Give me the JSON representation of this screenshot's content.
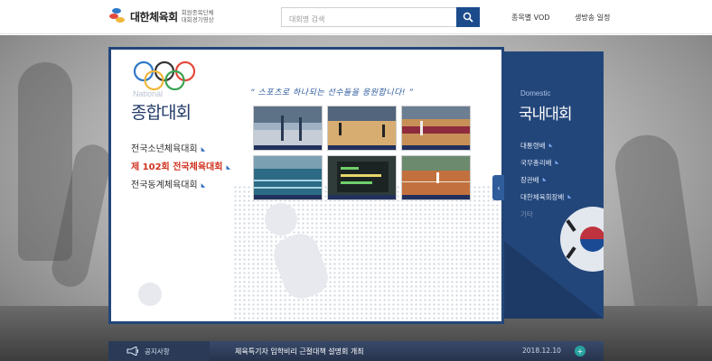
{
  "header": {
    "logo_name": "대한체육회",
    "logo_sub_line1": "회원종목단체",
    "logo_sub_line2": "대회경기영상",
    "search_placeholder": "대회명 검색",
    "nav": [
      "종목별 VOD",
      "생방송 일정"
    ]
  },
  "national": {
    "label": "National",
    "title": "종합대회",
    "menu": [
      {
        "label": "전국소년체육대회",
        "active": false
      },
      {
        "label": "제 102회 전국체육대회",
        "active": true
      },
      {
        "label": "전국동계체육대회",
        "active": false
      }
    ],
    "slogan": "“ 스포츠로 하나되는 선수들을 응원합니다! ”",
    "thumbnails": [
      "archery-hall",
      "basketball-court",
      "basketball-court-2",
      "swimming-pool",
      "scoreboard",
      "tennis-court"
    ]
  },
  "domestic": {
    "label": "Domestic",
    "title": "국내대회",
    "menu": [
      "대통령배",
      "국무총리배",
      "장관배",
      "대한체육회장배",
      "기타"
    ]
  },
  "notice": {
    "label": "공지사항",
    "text": "체육특기자 입학비리 근절대책 설명회 개최",
    "date": "2018.12.10",
    "more": "+"
  },
  "colors": {
    "navy": "#23467a",
    "active_red": "#d0321e",
    "accent_teal": "#27a2a0"
  },
  "icons": {
    "search": "magnifier-icon",
    "notice": "megaphone-icon",
    "arrow": "small-triangle-icon",
    "toggle": "chevron-left-icon"
  }
}
